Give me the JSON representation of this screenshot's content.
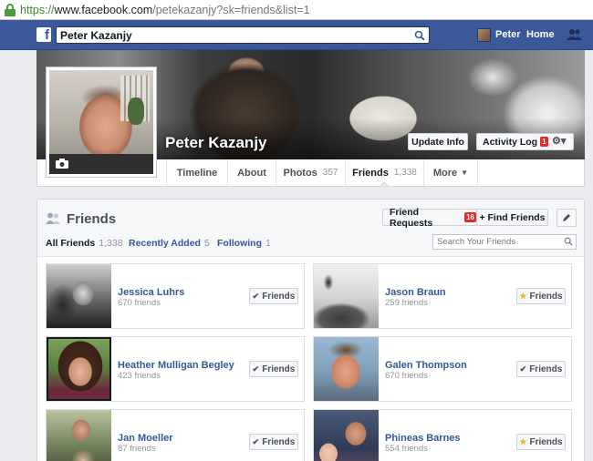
{
  "browser": {
    "url_scheme": "https://",
    "url_host": "www.facebook.com",
    "url_path": "/petekazanjy?sk=friends&list=1"
  },
  "topbar": {
    "search_value": "Peter Kazanjy",
    "user_name": "Peter",
    "home_label": "Home"
  },
  "profile": {
    "name": "Peter Kazanjy",
    "update_info_label": "Update Info",
    "activity_log_label": "Activity Log",
    "activity_log_badge": "1"
  },
  "tabs": [
    {
      "label": "Timeline",
      "count": ""
    },
    {
      "label": "About",
      "count": ""
    },
    {
      "label": "Photos",
      "count": "357"
    },
    {
      "label": "Friends",
      "count": "1,338"
    },
    {
      "label": "More",
      "count": ""
    }
  ],
  "friends_panel": {
    "title": "Friends",
    "friend_requests_label": "Friend Requests",
    "friend_requests_badge": "16",
    "find_friends_label": "+ Find Friends",
    "sub_tabs": [
      {
        "label": "All Friends",
        "count": "1,338"
      },
      {
        "label": "Recently Added",
        "count": "5"
      },
      {
        "label": "Following",
        "count": "1"
      }
    ],
    "search_placeholder": "Search Your Friends"
  },
  "friends": [
    {
      "name": "Jessica Luhrs",
      "count": "670 friends",
      "button": "Friends",
      "button_icon": "check-icon"
    },
    {
      "name": "Jason Braun",
      "count": "259 friends",
      "button": "Friends",
      "button_icon": "star-icon"
    },
    {
      "name": "Heather Mulligan Begley",
      "count": "423 friends",
      "button": "Friends",
      "button_icon": "check-icon"
    },
    {
      "name": "Galen Thompson",
      "count": "670 friends",
      "button": "Friends",
      "button_icon": "check-icon"
    },
    {
      "name": "Jan Moeller",
      "count": "87 friends",
      "button": "Friends",
      "button_icon": "check-icon"
    },
    {
      "name": "Phineas Barnes",
      "count": "554 friends",
      "button": "Friends",
      "button_icon": "star-icon"
    }
  ],
  "colors": {
    "brand_blue": "#3b5998",
    "link_blue": "#365899",
    "badge_red": "#e32a28",
    "star_yellow": "#f0b323"
  }
}
